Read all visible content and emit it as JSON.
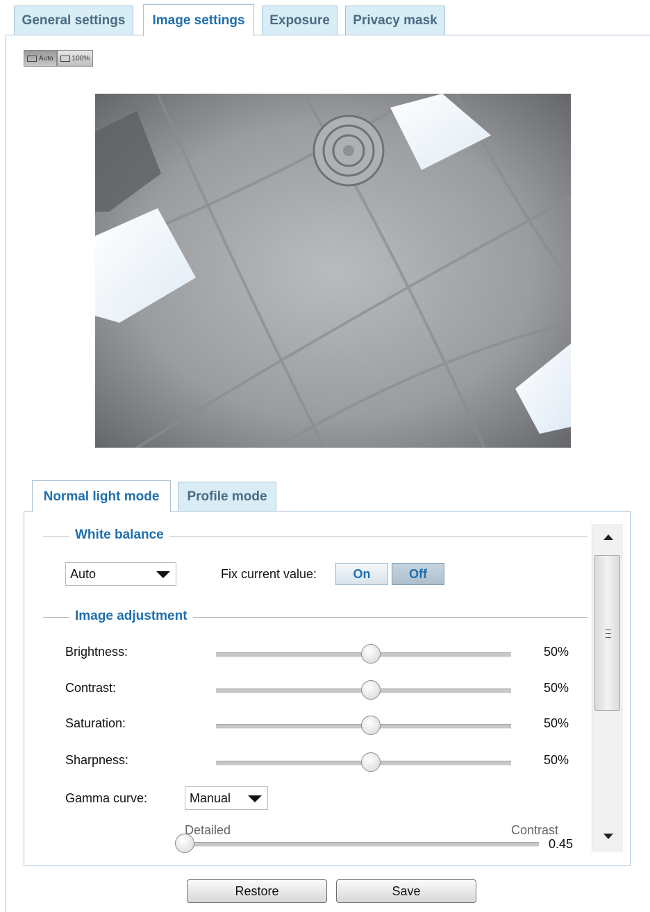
{
  "tabs": [
    {
      "label": "General settings"
    },
    {
      "label": "Image settings"
    },
    {
      "label": "Exposure"
    },
    {
      "label": "Privacy mask"
    }
  ],
  "view_buttons": {
    "auto": "Auto",
    "full": "100%"
  },
  "mode_tabs": [
    {
      "label": "Normal light mode"
    },
    {
      "label": "Profile mode"
    }
  ],
  "white_balance": {
    "title": "White balance",
    "select_value": "Auto",
    "fix_label": "Fix current value:",
    "on_label": "On",
    "off_label": "Off",
    "selected": "Off"
  },
  "image_adjustment": {
    "title": "Image adjustment",
    "sliders": [
      {
        "label": "Brightness:",
        "value_text": "50%",
        "value": 50
      },
      {
        "label": "Contrast:",
        "value_text": "50%",
        "value": 50
      },
      {
        "label": "Saturation:",
        "value_text": "50%",
        "value": 50
      },
      {
        "label": "Sharpness:",
        "value_text": "50%",
        "value": 50
      }
    ],
    "gamma": {
      "label": "Gamma curve:",
      "select_value": "Manual",
      "left_label": "Detailed",
      "right_label": "Contrast",
      "value_text": "0.45",
      "value": 0.0
    }
  },
  "buttons": {
    "restore": "Restore",
    "save": "Save"
  },
  "colors": {
    "accent": "#1f6fae",
    "tab_bg": "#d9edf6",
    "border": "#a9c3d6"
  }
}
